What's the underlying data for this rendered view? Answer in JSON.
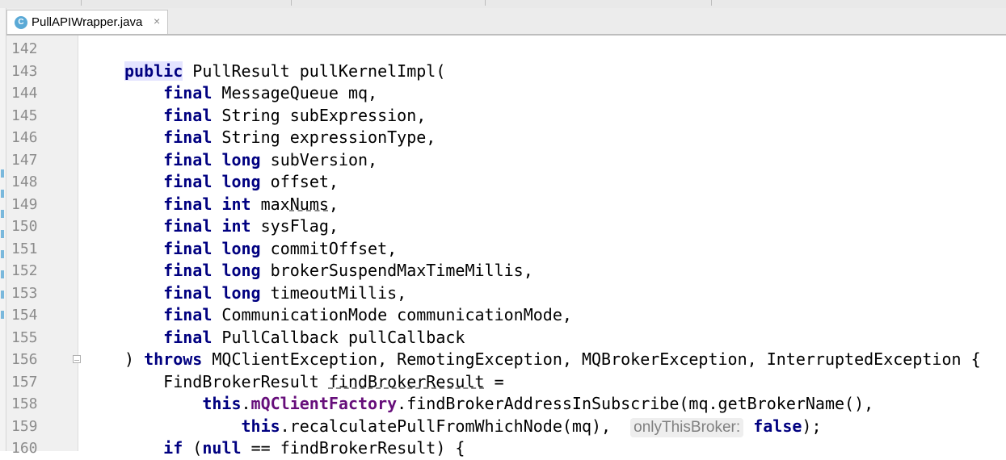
{
  "editor": {
    "tab": {
      "icon_letter": "C",
      "file_name": "PullAPIWrapper.java",
      "close_glyph": "×"
    },
    "colors": {
      "keyword": "#000080",
      "field": "#660e7a",
      "line_number": "#8c8c8c",
      "gutter_bg": "#f0f0f0"
    },
    "lines": [
      {
        "num": "142",
        "tokens": []
      },
      {
        "num": "143",
        "tokens": [
          {
            "t": "public",
            "c": "kw hl"
          },
          {
            "t": " PullResult pullKernelImpl("
          }
        ]
      },
      {
        "num": "144",
        "tokens": [
          {
            "t": "    "
          },
          {
            "t": "final",
            "c": "kw"
          },
          {
            "t": " MessageQueue mq,"
          }
        ]
      },
      {
        "num": "145",
        "tokens": [
          {
            "t": "    "
          },
          {
            "t": "final",
            "c": "kw"
          },
          {
            "t": " String subExpression,"
          }
        ]
      },
      {
        "num": "146",
        "tokens": [
          {
            "t": "    "
          },
          {
            "t": "final",
            "c": "kw"
          },
          {
            "t": " String expressionType,"
          }
        ]
      },
      {
        "num": "147",
        "tokens": [
          {
            "t": "    "
          },
          {
            "t": "final",
            "c": "kw"
          },
          {
            "t": " "
          },
          {
            "t": "long",
            "c": "kw"
          },
          {
            "t": " subVersion,"
          }
        ]
      },
      {
        "num": "148",
        "tokens": [
          {
            "t": "    "
          },
          {
            "t": "final",
            "c": "kw"
          },
          {
            "t": " "
          },
          {
            "t": "long",
            "c": "kw"
          },
          {
            "t": " offset,"
          }
        ]
      },
      {
        "num": "149",
        "tokens": [
          {
            "t": "    "
          },
          {
            "t": "final",
            "c": "kw"
          },
          {
            "t": " "
          },
          {
            "t": "int",
            "c": "kw"
          },
          {
            "t": " max"
          },
          {
            "t": "Nums",
            "c": "ul"
          },
          {
            "t": ","
          }
        ]
      },
      {
        "num": "150",
        "tokens": [
          {
            "t": "    "
          },
          {
            "t": "final",
            "c": "kw"
          },
          {
            "t": " "
          },
          {
            "t": "int",
            "c": "kw"
          },
          {
            "t": " sysFlag,"
          }
        ]
      },
      {
        "num": "151",
        "tokens": [
          {
            "t": "    "
          },
          {
            "t": "final",
            "c": "kw"
          },
          {
            "t": " "
          },
          {
            "t": "long",
            "c": "kw"
          },
          {
            "t": " commitOffset,"
          }
        ]
      },
      {
        "num": "152",
        "tokens": [
          {
            "t": "    "
          },
          {
            "t": "final",
            "c": "kw"
          },
          {
            "t": " "
          },
          {
            "t": "long",
            "c": "kw"
          },
          {
            "t": " brokerSuspendMaxTimeMillis,"
          }
        ]
      },
      {
        "num": "153",
        "tokens": [
          {
            "t": "    "
          },
          {
            "t": "final",
            "c": "kw"
          },
          {
            "t": " "
          },
          {
            "t": "long",
            "c": "kw"
          },
          {
            "t": " timeoutMillis,"
          }
        ]
      },
      {
        "num": "154",
        "tokens": [
          {
            "t": "    "
          },
          {
            "t": "final",
            "c": "kw"
          },
          {
            "t": " CommunicationMode communicationMode,"
          }
        ]
      },
      {
        "num": "155",
        "tokens": [
          {
            "t": "    "
          },
          {
            "t": "final",
            "c": "kw"
          },
          {
            "t": " PullCallback pullCallback"
          }
        ]
      },
      {
        "num": "156",
        "tokens": [
          {
            "t": ") "
          },
          {
            "t": "throws",
            "c": "kw"
          },
          {
            "t": " MQClientException, RemotingException, MQBrokerException, InterruptedException {"
          }
        ]
      },
      {
        "num": "157",
        "tokens": [
          {
            "t": "    FindBrokerResult "
          },
          {
            "t": "findBrokerResult",
            "c": "ul"
          },
          {
            "t": " ="
          }
        ]
      },
      {
        "num": "158",
        "tokens": [
          {
            "t": "        "
          },
          {
            "t": "this",
            "c": "kw"
          },
          {
            "t": "."
          },
          {
            "t": "mQClientFactory",
            "c": "fld"
          },
          {
            "t": ".findBrokerAddressInSubscribe(mq.getBrokerName(),"
          }
        ]
      },
      {
        "num": "159",
        "tokens": [
          {
            "t": "            "
          },
          {
            "t": "this",
            "c": "kw"
          },
          {
            "t": ".recalculatePullFromWhichNode(mq),  "
          },
          {
            "t": "onlyThisBroker:",
            "c": "hint"
          },
          {
            "t": " "
          },
          {
            "t": "false",
            "c": "kw"
          },
          {
            "t": ");"
          }
        ]
      },
      {
        "num": "160",
        "tokens": [
          {
            "t": "    "
          },
          {
            "t": "if",
            "c": "kw"
          },
          {
            "t": " ("
          },
          {
            "t": "null",
            "c": "kw"
          },
          {
            "t": " == findBrokerResult) {"
          }
        ]
      }
    ]
  }
}
